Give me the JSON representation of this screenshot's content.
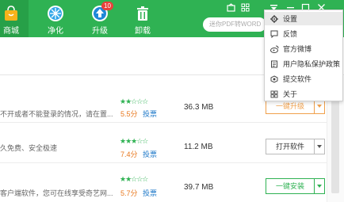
{
  "nav": [
    {
      "label": "商城",
      "icon": "store-bag-icon"
    },
    {
      "label": "净化",
      "icon": "purify-icon"
    },
    {
      "label": "升级",
      "icon": "upgrade-icon",
      "badge": "10"
    },
    {
      "label": "卸载",
      "icon": "uninstall-trash-icon"
    }
  ],
  "search": {
    "placeholder": "迷你PDF转WORD"
  },
  "menu": [
    {
      "label": "设置",
      "icon": "gear-icon"
    },
    {
      "label": "反馈",
      "icon": "feedback-icon"
    },
    {
      "label": "官方微博",
      "icon": "weibo-icon"
    },
    {
      "label": "用户隐私保护政策",
      "icon": "privacy-policy-icon"
    },
    {
      "label": "提交软件",
      "icon": "submit-software-icon"
    },
    {
      "label": "关于",
      "icon": "about-icon"
    }
  ],
  "rows": [
    {
      "desc": "不开或者不能登录的情况，请在置...",
      "stars": "★★☆☆☆",
      "score": "5.5分",
      "vote": "投票",
      "size": "36.3 MB",
      "button": "一键升级"
    },
    {
      "desc": "久免费、安全极速",
      "stars": "★★★☆☆",
      "score": "7.4分",
      "vote": "投票",
      "size": "11.2 MB",
      "button": "打开软件"
    },
    {
      "desc": "客户端软件，您可在线享受奇艺网...",
      "stars": "★★☆☆☆",
      "score": "5.7分",
      "vote": "投票",
      "size": "39.7 MB",
      "button": "一键安装"
    }
  ],
  "colors": {
    "brand_green": "#2fb253",
    "badge_red": "#e8403a",
    "score_orange": "#e8771d",
    "vote_blue": "#1e78c8"
  }
}
